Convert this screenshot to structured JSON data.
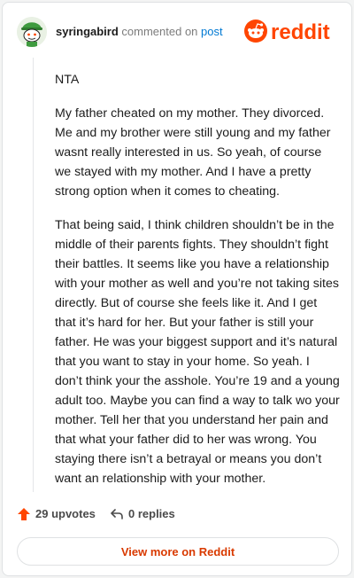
{
  "header": {
    "username": "syringabird",
    "action_text": "commented on",
    "post_link": "post",
    "logo_text": "reddit"
  },
  "comment": {
    "paragraphs": [
      "NTA",
      "My father cheated on my mother. They divorced. Me and my brother were still young and my father wasnt really interested in us. So yeah, of course we stayed with my mother. And I have a pretty strong option when it comes to cheating.",
      "That being said, I think children shouldn’t be in the middle of their parents fights. They shouldn’t fight their battles. It seems like you have a relationship with your mother as well and you’re not taking sites directly. But of course she feels like it. And I get that it’s hard for her. But your father is still your father. He was your biggest support and it’s natural that you want to stay in your home. So yeah. I don’t think your the asshole. You’re 19 and a young adult too. Maybe you can find a way to talk wo your mother. Tell her that you understand her pain and that what your father did to her was wrong. You staying there isn’t a betrayal or means you don’t want an relationship with your mother."
    ]
  },
  "actions": {
    "upvotes_label": "29 upvotes",
    "replies_label": "0 replies"
  },
  "footer": {
    "view_more_label": "View more on Reddit"
  },
  "colors": {
    "brand": "#ff4500",
    "link": "#0079d3",
    "button_text": "#d93a00"
  },
  "icons": {
    "avatar": "snoo-avatar-icon",
    "logo": "reddit-logo-icon",
    "upvote": "upvote-arrow-icon",
    "reply": "reply-arrow-icon"
  }
}
